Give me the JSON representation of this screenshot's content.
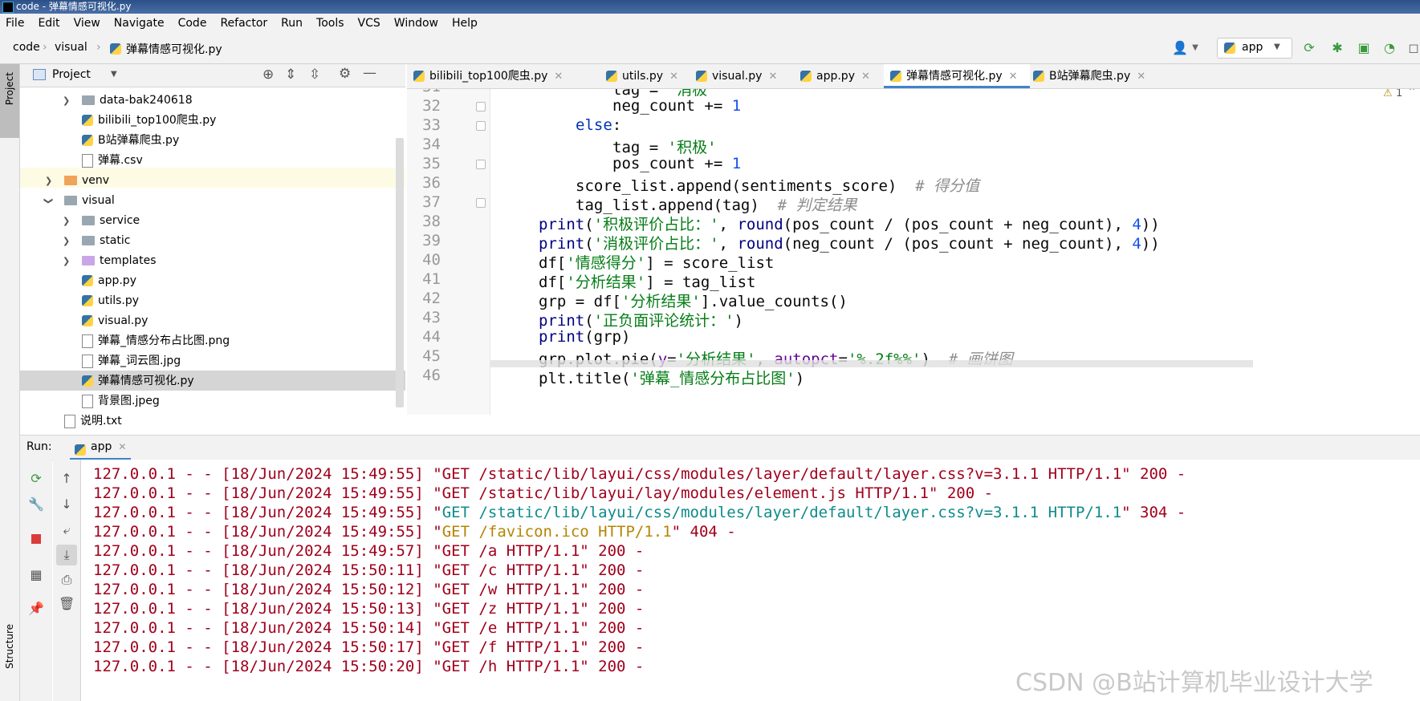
{
  "window": {
    "title": "code - 弹幕情感可视化.py"
  },
  "menu": [
    "File",
    "Edit",
    "View",
    "Navigate",
    "Code",
    "Refactor",
    "Run",
    "Tools",
    "VCS",
    "Window",
    "Help"
  ],
  "breadcrumb": {
    "root": "code",
    "folder": "visual",
    "file": "弹幕情感可视化.py"
  },
  "toolbar": {
    "run_config": "app"
  },
  "project_panel": {
    "title": "Project",
    "items": [
      {
        "label": "data-bak240618",
        "kind": "folder",
        "color": "#9aa7b0"
      },
      {
        "label": "bilibili_top100爬虫.py",
        "kind": "py"
      },
      {
        "label": "B站弹幕爬虫.py",
        "kind": "py"
      },
      {
        "label": "弹幕.csv",
        "kind": "file"
      },
      {
        "label": "venv",
        "kind": "folder",
        "color": "#f0a35a"
      },
      {
        "label": "visual",
        "kind": "folder",
        "color": "#9aa7b0"
      },
      {
        "label": "service",
        "kind": "folder",
        "color": "#9aa7b0"
      },
      {
        "label": "static",
        "kind": "folder",
        "color": "#9aa7b0"
      },
      {
        "label": "templates",
        "kind": "folder",
        "color": "#c9a6e6"
      },
      {
        "label": "app.py",
        "kind": "py"
      },
      {
        "label": "utils.py",
        "kind": "py"
      },
      {
        "label": "visual.py",
        "kind": "py"
      },
      {
        "label": "弹幕_情感分布占比图.png",
        "kind": "file"
      },
      {
        "label": "弹幕_词云图.jpg",
        "kind": "file"
      },
      {
        "label": "弹幕情感可视化.py",
        "kind": "py"
      },
      {
        "label": "背景图.jpeg",
        "kind": "file"
      },
      {
        "label": "说明.txt",
        "kind": "file"
      }
    ]
  },
  "editor": {
    "tabs": [
      "bilibili_top100爬虫.py",
      "utils.py",
      "visual.py",
      "app.py",
      "弹幕情感可视化.py",
      "B站弹幕爬虫.py"
    ],
    "active_tab": 4,
    "warning_count": "1",
    "line_numbers": [
      "31",
      "32",
      "33",
      "34",
      "35",
      "36",
      "37",
      "38",
      "39",
      "40",
      "41",
      "42",
      "43",
      "44",
      "45",
      "46"
    ]
  },
  "run": {
    "label": "Run:",
    "tab": "app",
    "lines": [
      "127.0.0.1 - - [18/Jun/2024 15:49:55] \"GET /static/lib/layui/css/modules/layer/default/layer.css?v=3.1.1 HTTP/1.1\" 200 -",
      "127.0.0.1 - - [18/Jun/2024 15:49:55] \"GET /static/lib/layui/lay/modules/element.js HTTP/1.1\" 200 -",
      "127.0.0.1 - - [18/Jun/2024 15:49:55] \"",
      "127.0.0.1 - - [18/Jun/2024 15:49:55] \"",
      "127.0.0.1 - - [18/Jun/2024 15:49:57] \"GET /a HTTP/1.1\" 200 -",
      "127.0.0.1 - - [18/Jun/2024 15:50:11] \"GET /c HTTP/1.1\" 200 -",
      "127.0.0.1 - - [18/Jun/2024 15:50:12] \"GET /w HTTP/1.1\" 200 -",
      "127.0.0.1 - - [18/Jun/2024 15:50:13] \"GET /z HTTP/1.1\" 200 -",
      "127.0.0.1 - - [18/Jun/2024 15:50:14] \"GET /e HTTP/1.1\" 200 -",
      "127.0.0.1 - - [18/Jun/2024 15:50:17] \"GET /f HTTP/1.1\" 200 -",
      "127.0.0.1 - - [18/Jun/2024 15:50:20] \"GET /h HTTP/1.1\" 200 -"
    ],
    "line3_colored": "GET /static/lib/layui/css/modules/layer/default/layer.css?v=3.1.1 HTTP/1.1",
    "line3_tail": "\" 304 -",
    "line4_colored": "GET /favicon.ico HTTP/1.1",
    "line4_tail": "\" 404 -"
  },
  "sidebar_labels": {
    "project": "Project",
    "structure": "Structure"
  },
  "watermark": "CSDN @B站计算机毕业设计大学"
}
